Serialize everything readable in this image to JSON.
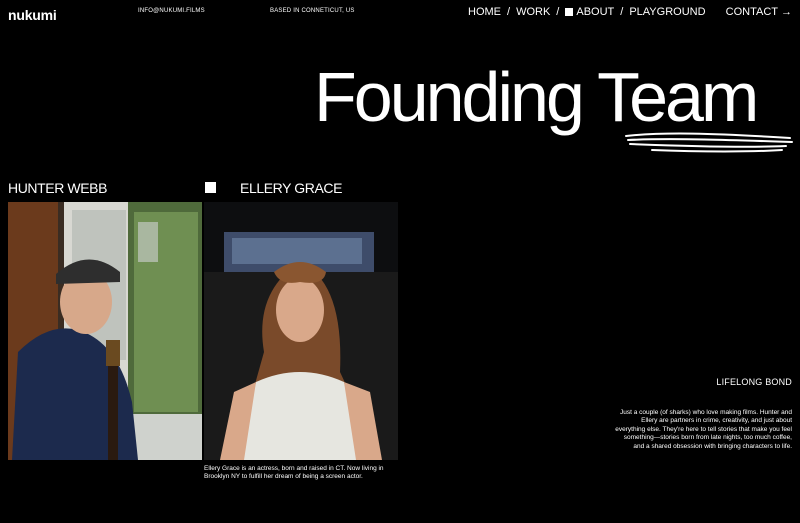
{
  "header": {
    "logo": "nukumi",
    "email": "INFO@NUKUMI.FILMS",
    "location": "BASED IN CONNETICUT, US",
    "nav": [
      {
        "label": "HOME"
      },
      {
        "label": "WORK"
      },
      {
        "label": "ABOUT",
        "active": true
      },
      {
        "label": "PLAYGROUND"
      }
    ],
    "separator": "/",
    "contact_label": "CONTACT",
    "contact_arrow": "→"
  },
  "hero": {
    "title": "Founding Team"
  },
  "team": {
    "members": [
      {
        "name": "HUNTER WEBB",
        "photo_icon": "portrait-photo"
      },
      {
        "name": "ELLERY GRACE",
        "photo_icon": "portrait-photo",
        "caption": "Ellery Grace is an actress, born and raised in CT. Now living in Brooklyn NY to fulfill her dream of being a screen actor."
      }
    ]
  },
  "about": {
    "heading": "LIFELONG BOND",
    "body": "Just a couple (of sharks) who love making films. Hunter and Ellery are partners in crime, creativity, and just about everything else. They're here to tell stories that make you feel something—stories born from late nights, too much coffee, and a shared obsession with bringing characters to life."
  },
  "colors": {
    "background": "#000000",
    "text": "#ffffff"
  }
}
